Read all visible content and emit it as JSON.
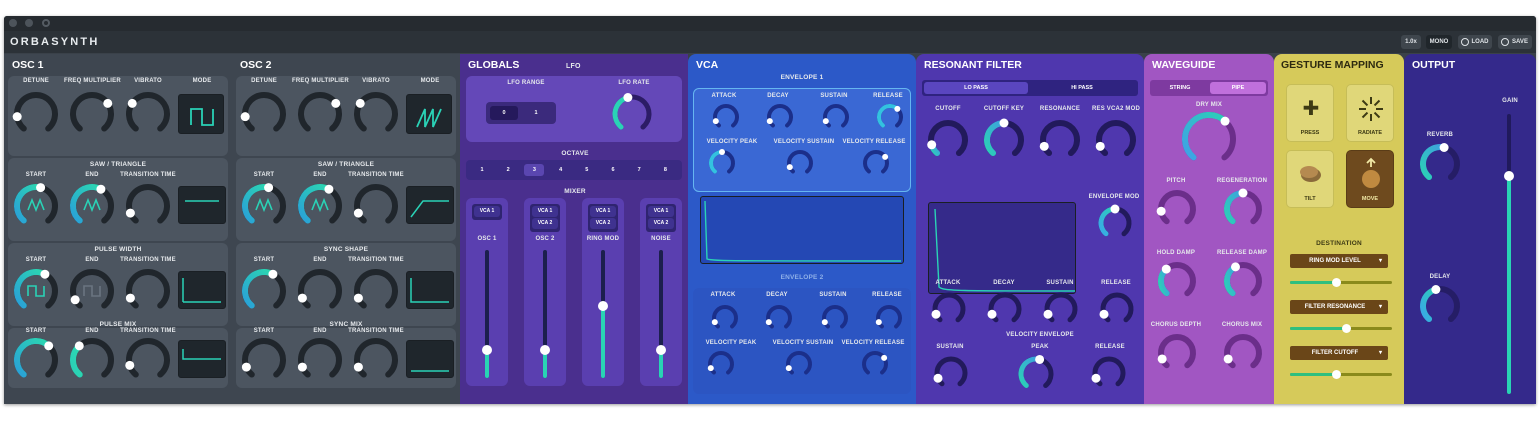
{
  "app": {
    "logo": "ORBASYNTH",
    "window_controls": [
      "close-icon",
      "minimize-icon",
      "settings-icon"
    ],
    "header_buttons": {
      "zoom": "1.0x",
      "mono": "MONO",
      "load": "LOAD",
      "save": "SAVE"
    }
  },
  "osc1": {
    "title": "OSC 1",
    "top_labels": [
      "DETUNE",
      "FREQ MULTIPLIER",
      "VIBRATO",
      "MODE"
    ],
    "saw_title": "SAW / TRIANGLE",
    "pulse_title": "PULSE WIDTH",
    "mix_title": "PULSE MIX",
    "sub_labels": [
      "START",
      "END",
      "TRANSITION TIME"
    ]
  },
  "osc2": {
    "title": "OSC 2",
    "top_labels": [
      "DETUNE",
      "FREQ MULTIPLIER",
      "VIBRATO",
      "MODE"
    ],
    "saw_title": "SAW / TRIANGLE",
    "sync_shape_title": "SYNC SHAPE",
    "sync_mix_title": "SYNC MIX",
    "sub_labels": [
      "START",
      "END",
      "TRANSITION TIME"
    ]
  },
  "globals": {
    "title": "GLOBALS",
    "lfo": "LFO",
    "lfo_range": "LFO RANGE",
    "lfo_rate": "LFO RATE",
    "lfo_range_options": [
      "0",
      "1"
    ],
    "octave": "OCTAVE",
    "octave_options": [
      "1",
      "2",
      "3",
      "4",
      "5",
      "6",
      "7",
      "8"
    ],
    "mixer": "MIXER",
    "channels": [
      {
        "name": "OSC 1",
        "routes": [
          "VCA 1"
        ],
        "level": 0.22
      },
      {
        "name": "OSC 2",
        "routes": [
          "VCA 1",
          "VCA 2"
        ],
        "level": 0.22
      },
      {
        "name": "RING MOD",
        "routes": [
          "VCA 1",
          "VCA 2"
        ],
        "level": 0.56
      },
      {
        "name": "NOISE",
        "routes": [
          "VCA 1",
          "VCA 2"
        ],
        "level": 0.22
      }
    ]
  },
  "vca": {
    "title": "VCA",
    "env1": "ENVELOPE 1",
    "env2": "ENVELOPE 2",
    "env_labels": [
      "ATTACK",
      "DECAY",
      "SUSTAIN",
      "RELEASE"
    ],
    "vel_labels": [
      "VELOCITY PEAK",
      "VELOCITY SUSTAIN",
      "VELOCITY RELEASE"
    ]
  },
  "filter": {
    "title": "RESONANT FILTER",
    "modes": [
      "LO PASS",
      "HI PASS"
    ],
    "top_labels": [
      "CUTOFF",
      "CUTOFF KEY",
      "RESONANCE",
      "RES VCA2 MOD"
    ],
    "env_mod": "ENVELOPE MOD",
    "env_labels": [
      "ATTACK",
      "DECAY",
      "SUSTAIN",
      "RELEASE"
    ],
    "sustain": "SUSTAIN",
    "vel_env": "VELOCITY ENVELOPE",
    "peak": "PEAK",
    "release": "RELEASE"
  },
  "waveguide": {
    "title": "WAVEGUIDE",
    "modes": [
      "STRING",
      "PIPE"
    ],
    "dry_mix": "DRY MIX",
    "labels": [
      "PITCH",
      "REGENERATION",
      "HOLD DAMP",
      "RELEASE DAMP",
      "CHORUS DEPTH",
      "CHORUS MIX"
    ]
  },
  "gesture": {
    "title": "GESTURE MAPPING",
    "buttons": [
      "PRESS",
      "RADIATE",
      "TILT",
      "MOVE"
    ],
    "destination": "DESTINATION",
    "destinations": [
      {
        "label": "RING MOD LEVEL",
        "value": 0.45
      },
      {
        "label": "FILTER RESONANCE",
        "value": 0.55
      },
      {
        "label": "FILTER CUTOFF",
        "value": 0.45
      }
    ]
  },
  "output": {
    "title": "OUTPUT",
    "reverb": "REVERB",
    "delay": "DELAY",
    "gain": "GAIN",
    "gain_value": 0.78
  },
  "colors": {
    "osc": "#4b5561",
    "globals": "#5b3ea9",
    "vca": "#3160cd",
    "filter": "#5a43b9",
    "waveguide": "#a65bc7",
    "gesture": "#d9cd5c",
    "output": "#3a2f92",
    "teal": "#2ad2b6"
  }
}
